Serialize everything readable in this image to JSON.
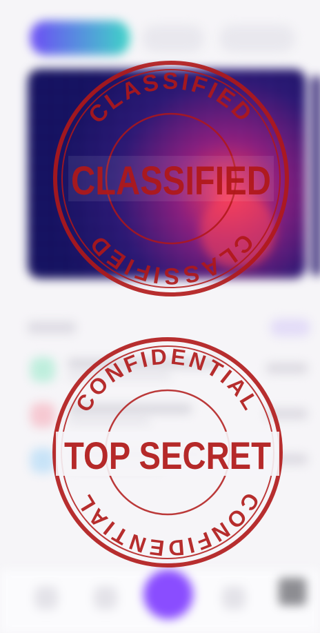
{
  "stamps": {
    "top": {
      "ring_top": "CLASSIFIED",
      "center": "CLASSIFIED",
      "ring_bottom": "CLASSIFIED"
    },
    "bottom": {
      "ring_top": "CONFIDENTIAL",
      "center": "TOP SECRET",
      "ring_bottom": "CONFIDENTIAL"
    }
  },
  "colors": {
    "stamp": "#b01818",
    "accent": "#8a4dff",
    "tab_gradient_start": "#6d4df5",
    "tab_gradient_end": "#3fd4c7",
    "transaction_dots": [
      "#bfeedd",
      "#f6c9d2",
      "#c8e3f7"
    ]
  },
  "icons": {
    "nav": [
      "home-icon",
      "chart-icon",
      "add-icon",
      "wallet-icon",
      "profile-icon"
    ]
  }
}
